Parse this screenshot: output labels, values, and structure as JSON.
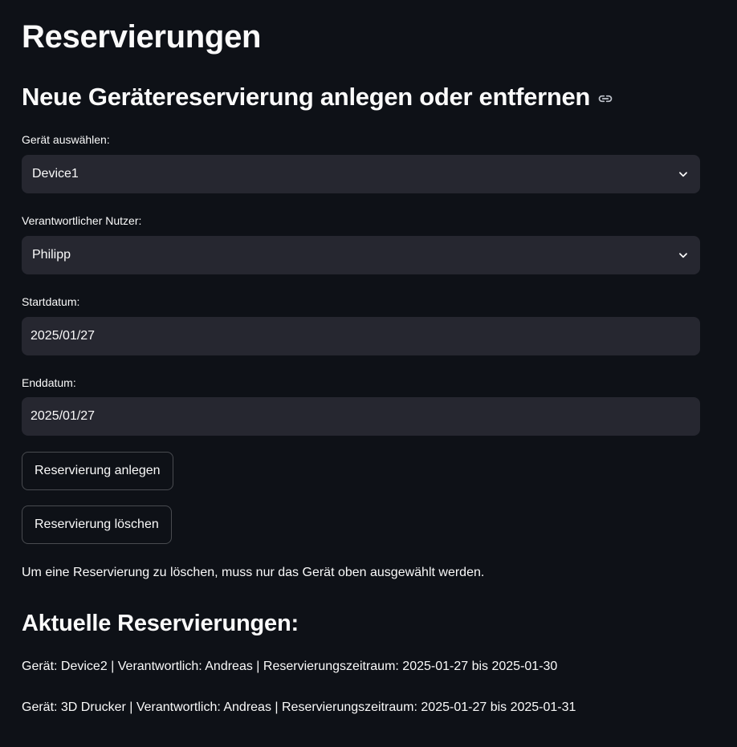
{
  "page_title": "Reservierungen",
  "section_title": "Neue Gerätereservierung anlegen oder entfernen",
  "form": {
    "device": {
      "label": "Gerät auswählen:",
      "value": "Device1"
    },
    "user": {
      "label": "Verantwortlicher Nutzer:",
      "value": "Philipp"
    },
    "start": {
      "label": "Startdatum:",
      "value": "2025/01/27"
    },
    "end": {
      "label": "Enddatum:",
      "value": "2025/01/27"
    }
  },
  "buttons": {
    "create": "Reservierung anlegen",
    "delete": "Reservierung löschen"
  },
  "info_text": "Um eine Reservierung zu löschen, muss nur das Gerät oben ausgewählt werden.",
  "current": {
    "title": "Aktuelle Reservierungen:",
    "items": [
      "Gerät: Device2 | Verantwortlich: Andreas | Reservierungszeitraum: 2025-01-27 bis 2025-01-30",
      "Gerät: 3D Drucker | Verantwortlich: Andreas | Reservierungszeitraum: 2025-01-27 bis 2025-01-31"
    ]
  },
  "icons": {
    "anchor": "link-icon",
    "dropdown": "chevron-down-icon"
  },
  "colors": {
    "background": "#0e1117",
    "input_background": "#262730",
    "text": "#fafafa"
  }
}
